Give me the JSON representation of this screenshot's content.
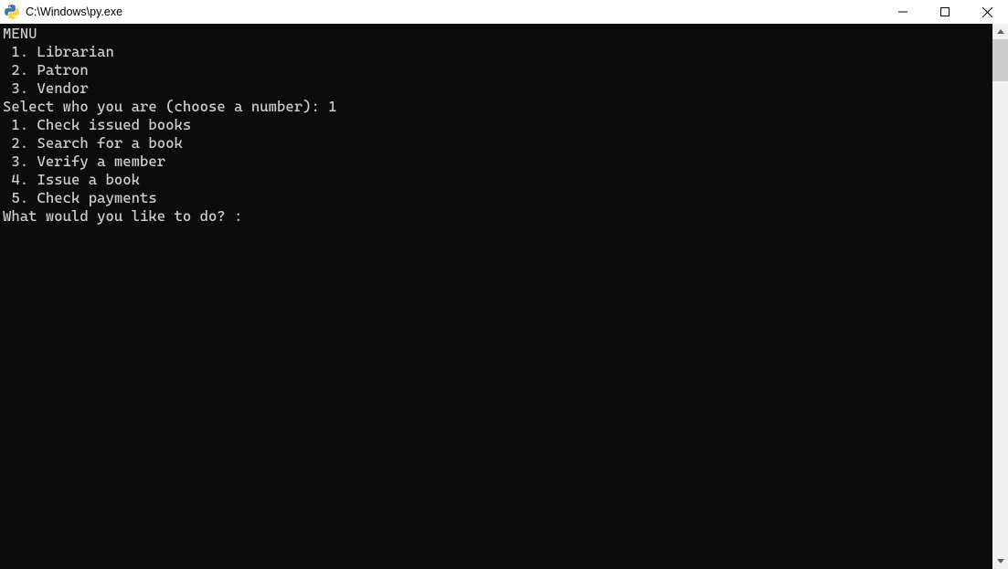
{
  "window": {
    "title": "C:\\Windows\\py.exe"
  },
  "terminal": {
    "lines": [
      "MENU",
      " 1. Librarian",
      " 2. Patron",
      " 3. Vendor",
      "Select who you are (choose a number): 1",
      " 1. Check issued books",
      " 2. Search for a book",
      " 3. Verify a member",
      " 4. Issue a book",
      " 5. Check payments",
      "What would you like to do? :"
    ]
  }
}
